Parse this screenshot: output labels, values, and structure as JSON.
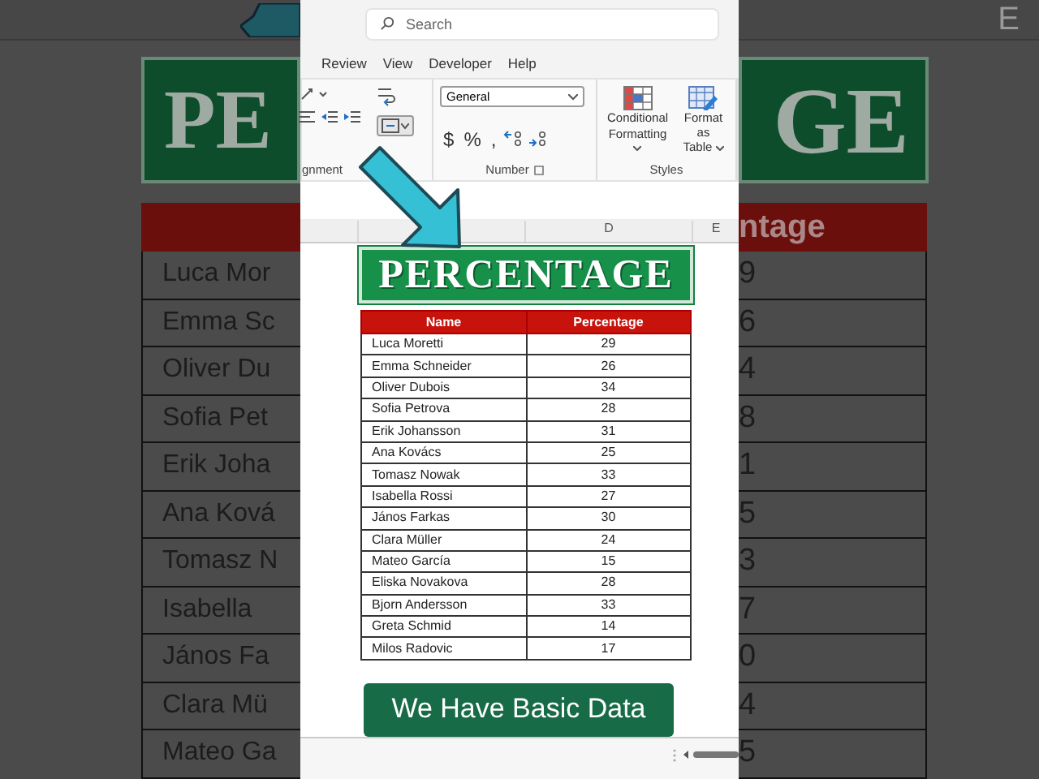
{
  "backdrop_left": {
    "title": "PE",
    "rows": [
      "Luca Mor",
      "Emma Sc",
      "Oliver Du",
      "Sofia Pet",
      "Erik Joha",
      "Ana Ková",
      "Tomasz N",
      "Isabella",
      "János Fa",
      "Clara Mü",
      "Mateo Ga"
    ]
  },
  "backdrop_right": {
    "column_header": "E",
    "title": "GE",
    "header": "ntage",
    "rows": [
      "9",
      "6",
      "4",
      "8",
      "1",
      "5",
      "3",
      "7",
      "0",
      "4",
      "5"
    ]
  },
  "search": {
    "placeholder": "Search"
  },
  "ribbon_tabs": [
    "Review",
    "View",
    "Developer",
    "Help"
  ],
  "ribbon_groups": [
    {
      "label": "gnment"
    },
    {
      "label": "Number"
    },
    {
      "label": "Styles"
    }
  ],
  "number_format": "General",
  "number_buttons": [
    "$",
    "%",
    ","
  ],
  "style_buttons": [
    {
      "line1": "Conditional",
      "line2": "Formatting"
    },
    {
      "line1": "Format as",
      "line2": "Table"
    }
  ],
  "column_headers": [
    "D",
    "E"
  ],
  "title": "PERCENTAGE",
  "table": {
    "columns": [
      "Name",
      "Percentage"
    ],
    "rows": [
      [
        "Luca Moretti",
        "29"
      ],
      [
        "Emma Schneider",
        "26"
      ],
      [
        "Oliver Dubois",
        "34"
      ],
      [
        "Sofia Petrova",
        "28"
      ],
      [
        "Erik Johansson",
        "31"
      ],
      [
        "Ana Kovács",
        "25"
      ],
      [
        "Tomasz Nowak",
        "33"
      ],
      [
        "Isabella Rossi",
        "27"
      ],
      [
        "János Farkas",
        "30"
      ],
      [
        "Clara Müller",
        "24"
      ],
      [
        "Mateo García",
        "15"
      ],
      [
        "Eliska Novakova",
        "28"
      ],
      [
        "Bjorn Andersson",
        "33"
      ],
      [
        "Greta Schmid",
        "14"
      ],
      [
        "Milos Radovic",
        "17"
      ]
    ]
  },
  "caption_button": "We Have Basic Data"
}
